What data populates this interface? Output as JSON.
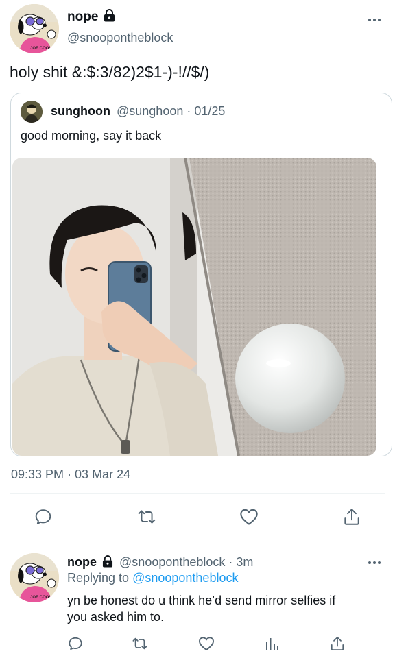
{
  "main_tweet": {
    "display_name": "nope",
    "handle": "@snoopontheblock",
    "text": "holy shit &:$:3/82)2$1-)-!//$/)",
    "timestamp": "09:33 PM · 03 Mar 24",
    "avatar_shirt_text": "JOE COOL"
  },
  "quoted_tweet": {
    "display_name": "sunghoon",
    "handle": "@sunghoon · 01/25",
    "text": "good morning, say it back"
  },
  "reply_tweet": {
    "display_name": "nope",
    "handle_time": "@snoopontheblock · 3m",
    "replying_prefix": "Replying to",
    "replying_handle": "@snoopontheblock",
    "text_line1": "yn be honest do u think he’d send mirror selfies if",
    "text_line2": "you asked him to.",
    "avatar_shirt_text": "JOE COOL"
  },
  "icons": {
    "lock": "lock-icon",
    "more": "more-icon",
    "reply": "reply-icon",
    "retweet": "retweet-icon",
    "like": "heart-icon",
    "analytics": "analytics-icon",
    "share": "share-icon"
  },
  "colors": {
    "text": "#0f1419",
    "muted": "#536471",
    "link": "#1d9bf0",
    "border": "#cfd9de",
    "divider": "#eff3f4"
  }
}
